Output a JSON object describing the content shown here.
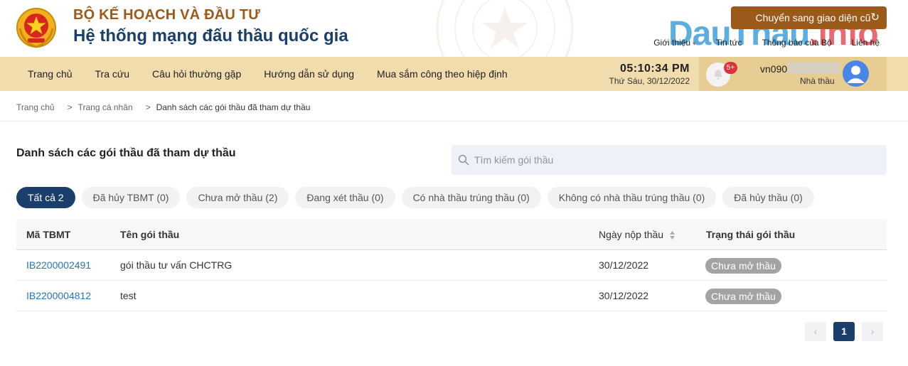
{
  "header": {
    "ministry": "BỘ KẾ HOẠCH VÀ ĐẦU TƯ",
    "system_name": "Hệ thống mạng đấu thầu quốc gia",
    "old_ui_button": "Chuyển sang giao diện cũ",
    "links": [
      "Giới thiệu",
      "Tin tức",
      "Thông báo của Bộ",
      "Liên hệ"
    ],
    "watermark_left": "DauThau",
    "watermark_right": ".info",
    "brand_color": "#9b5a1a",
    "primary_color": "#1b3f6b"
  },
  "nav": {
    "items": [
      "Trang chủ",
      "Tra cứu",
      "Câu hỏi thường gặp",
      "Hướng dẫn sử dụng",
      "Mua sắm công theo hiệp định"
    ],
    "time": "05:10:34 PM",
    "date": "Thứ Sáu, 30/12/2022",
    "notification_count": "5+",
    "username": "vn090",
    "role": "Nhà thầu"
  },
  "breadcrumb": {
    "items": [
      "Trang chủ",
      "Trang cá nhân",
      "Danh sách các gói thầu đã tham dự thầu"
    ],
    "separator": ">"
  },
  "main": {
    "title": "Danh sách các gói thầu đã tham dự thầu",
    "search_placeholder": "Tìm kiếm gói thầu",
    "tabs": [
      {
        "label": "Tất cả 2",
        "active": true
      },
      {
        "label": "Đã hủy TBMT (0)",
        "active": false
      },
      {
        "label": "Chưa mở thầu (2)",
        "active": false
      },
      {
        "label": "Đang xét thầu (0)",
        "active": false
      },
      {
        "label": "Có nhà thầu trúng thầu (0)",
        "active": false
      },
      {
        "label": "Không có nhà thầu trúng thầu (0)",
        "active": false
      },
      {
        "label": "Đã hủy thầu (0)",
        "active": false
      }
    ],
    "table": {
      "columns": [
        "Mã TBMT",
        "Tên gói thầu",
        "Ngày nộp thầu",
        "Trạng thái gói thầu"
      ],
      "rows": [
        {
          "code": "IB2200002491",
          "name": "gói thầu tư vấn CHCTRG",
          "date": "30/12/2022",
          "status": "Chưa mở thầu"
        },
        {
          "code": "IB2200004812",
          "name": "test",
          "date": "30/12/2022",
          "status": "Chưa mở thầu"
        }
      ]
    },
    "pagination": {
      "prev": "‹",
      "current": "1",
      "next": "›"
    }
  }
}
